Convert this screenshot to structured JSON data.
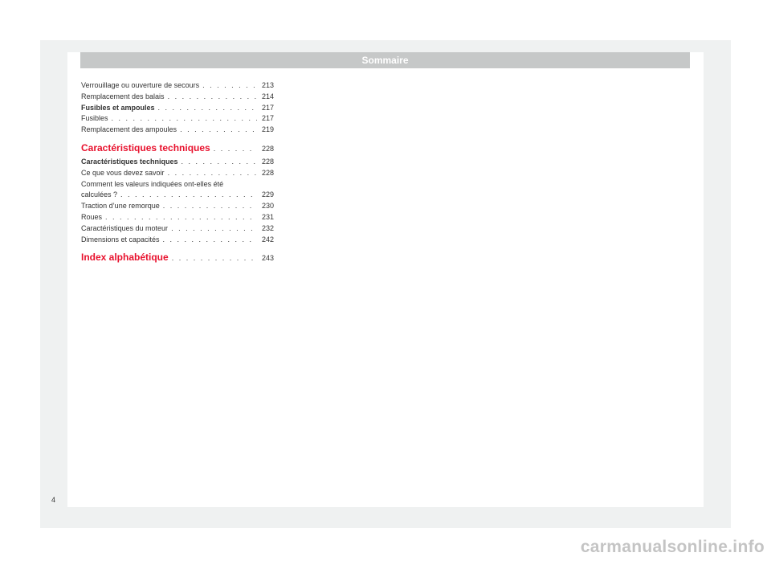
{
  "header": {
    "title": "Sommaire"
  },
  "toc": {
    "entries": [
      {
        "label": "Verrouillage ou ouverture de secours",
        "page": "213"
      },
      {
        "label": "Remplacement des balais",
        "page": "214"
      },
      {
        "label": "Fusibles et ampoules",
        "page": "217"
      },
      {
        "label": "Fusibles",
        "page": "217"
      },
      {
        "label": "Remplacement des ampoules",
        "page": "219"
      },
      {
        "label": "Caractéristiques techniques",
        "page": "228"
      },
      {
        "label": "Caractéristiques techniques",
        "page": "228"
      },
      {
        "label": "Ce que vous devez savoir",
        "page": "228"
      },
      {
        "label_line1": "Comment les valeurs indiquées ont-elles été",
        "label_line2": "calculées ?",
        "page": "229"
      },
      {
        "label": "Traction d’une remorque",
        "page": "230"
      },
      {
        "label": "Roues",
        "page": "231"
      },
      {
        "label": "Caractéristiques du moteur",
        "page": "232"
      },
      {
        "label": "Dimensions et capacités",
        "page": "242"
      },
      {
        "label": "Index alphabétique",
        "page": "243"
      }
    ]
  },
  "footer": {
    "page_number": "4"
  },
  "watermark": {
    "text": "carmanualsonline.info"
  },
  "colors": {
    "accent": "#e8112d",
    "header_bar": "#c6c8c8",
    "background": "#eff1f1"
  }
}
